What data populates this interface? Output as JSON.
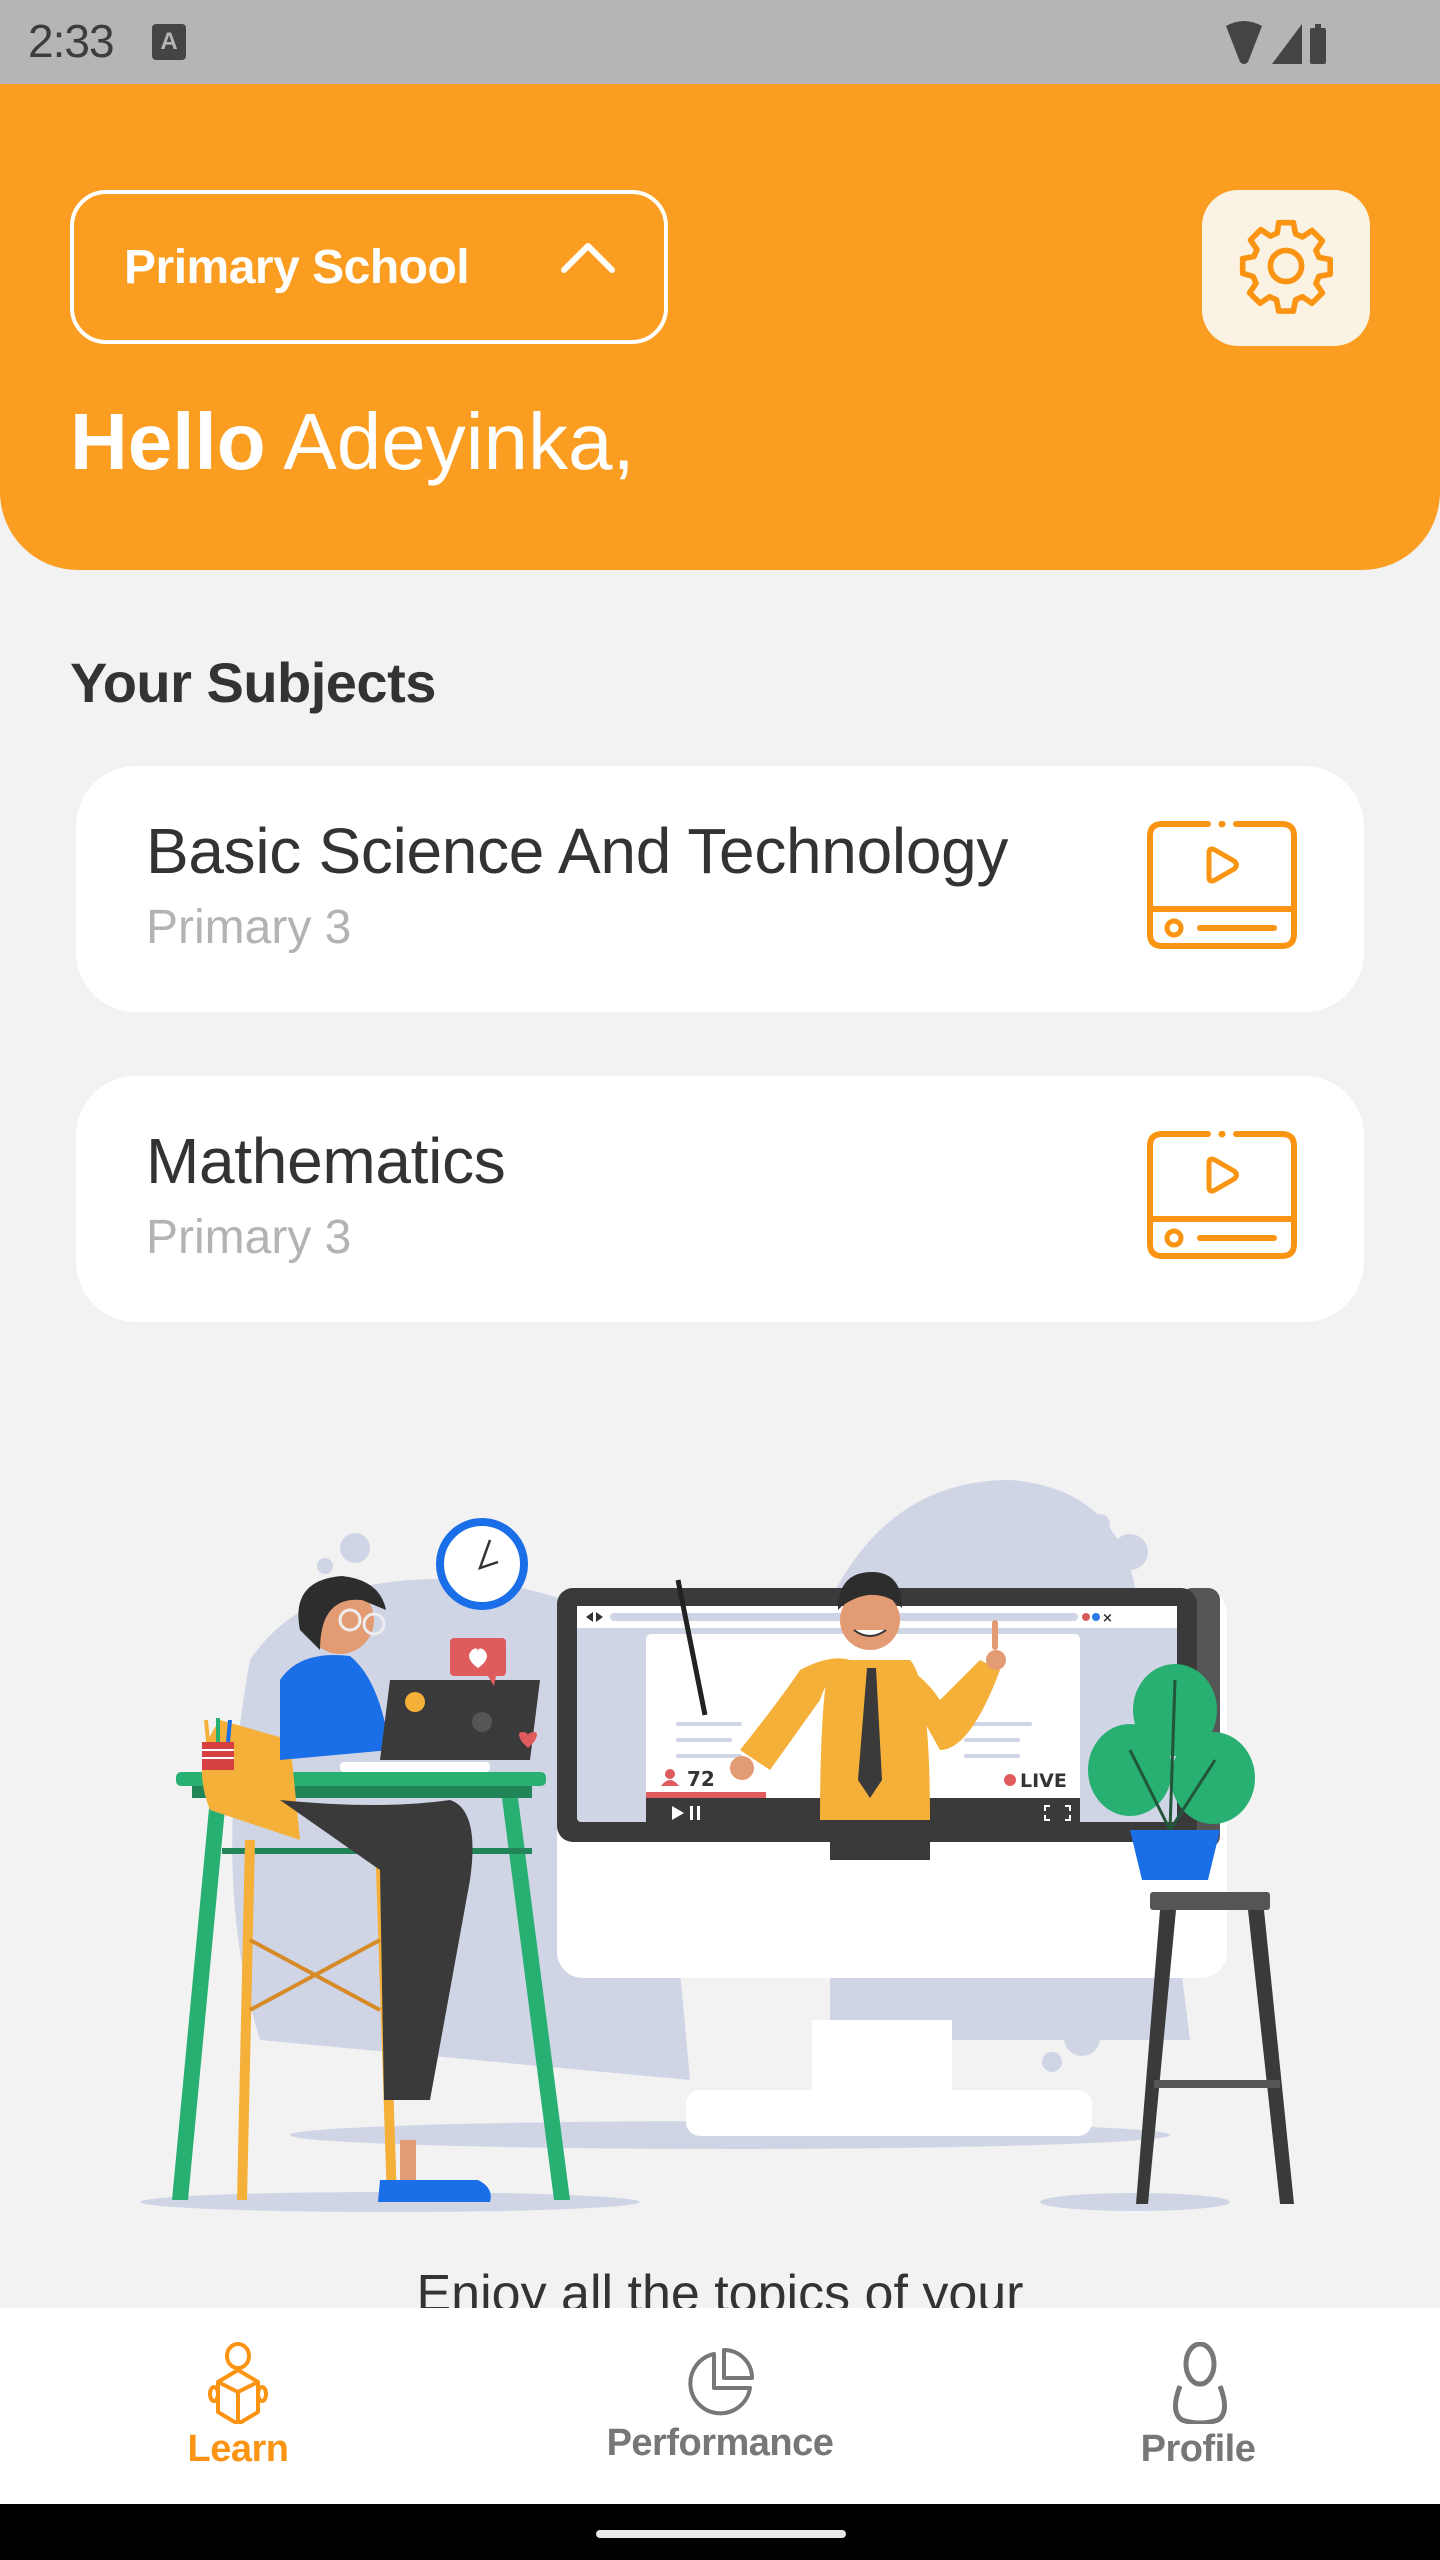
{
  "status_bar": {
    "time": "2:33",
    "notification_icon": "a-badge-icon",
    "right_icons": [
      "wifi-icon",
      "signal-icon",
      "battery-icon"
    ]
  },
  "header": {
    "level_selector": {
      "selected": "Primary School",
      "icon": "chevron-up-icon"
    },
    "settings_icon": "gear-icon",
    "greeting_bold": "Hello",
    "greeting_name": "Adeyinka,"
  },
  "subjects": {
    "title": "Your Subjects",
    "items": [
      {
        "name": "Basic Science And Technology",
        "level": "Primary 3",
        "icon": "video-player-icon"
      },
      {
        "name": "Mathematics",
        "level": "Primary 3",
        "icon": "video-player-icon"
      }
    ]
  },
  "illustration": {
    "description": "online-class-illustration",
    "viewer_count": "72",
    "live_label": "LIVE"
  },
  "tagline": "Enjoy all the topics of your",
  "bottom_nav": {
    "items": [
      {
        "label": "Learn",
        "icon": "reading-person-icon",
        "active": true
      },
      {
        "label": "Performance",
        "icon": "pie-chart-icon",
        "active": false
      },
      {
        "label": "Profile",
        "icon": "user-icon",
        "active": false
      }
    ]
  },
  "colors": {
    "accent": "#fb9d20",
    "icon_orange": "#fb9413",
    "inactive_nav": "#777777",
    "text_dark": "#333333",
    "text_muted": "#b3b3b3",
    "background": "#f2f2f2"
  }
}
